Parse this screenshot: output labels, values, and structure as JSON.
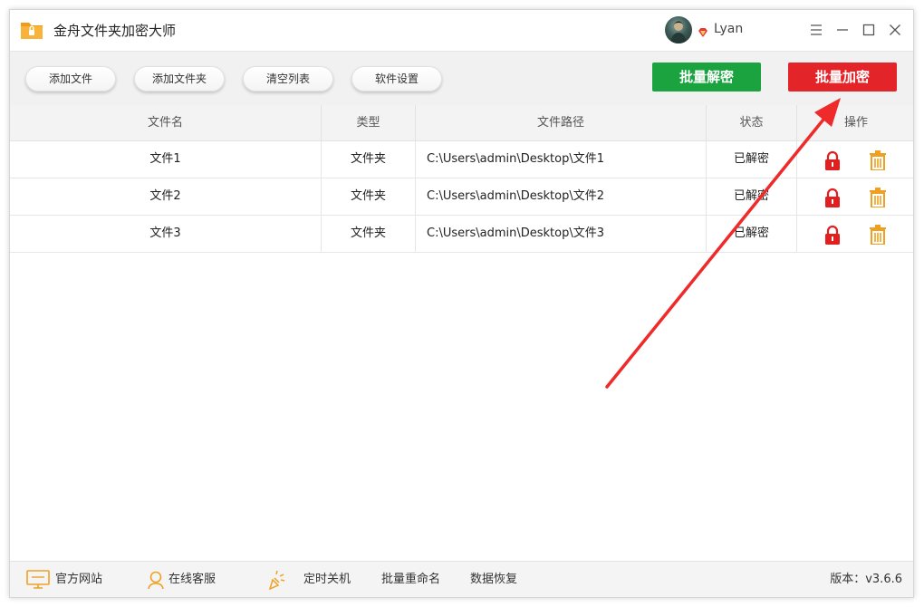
{
  "app": {
    "title": "金舟文件夹加密大师",
    "username": "Lyan"
  },
  "toolbar": {
    "add_file": "添加文件",
    "add_folder": "添加文件夹",
    "clear_list": "清空列表",
    "settings": "软件设置",
    "batch_decrypt": "批量解密",
    "batch_encrypt": "批量加密"
  },
  "table": {
    "headers": {
      "name": "文件名",
      "type": "类型",
      "path": "文件路径",
      "status": "状态",
      "actions": "操作"
    },
    "rows": [
      {
        "name": "文件1",
        "type": "文件夹",
        "path": "C:\\Users\\admin\\Desktop\\文件1",
        "status": "已解密"
      },
      {
        "name": "文件2",
        "type": "文件夹",
        "path": "C:\\Users\\admin\\Desktop\\文件2",
        "status": "已解密"
      },
      {
        "name": "文件3",
        "type": "文件夹",
        "path": "C:\\Users\\admin\\Desktop\\文件3",
        "status": "已解密"
      }
    ]
  },
  "footer": {
    "official_site": "官方网站",
    "online_support": "在线客服",
    "scheduled_shutdown": "定时关机",
    "batch_rename": "批量重命名",
    "data_recovery": "数据恢复",
    "version": "版本：v3.6.6"
  },
  "icons": {
    "logo": "folder-lock-icon",
    "vip": "vip-diamond-icon",
    "menu": "menu-icon",
    "minimize": "minimize-icon",
    "maximize": "maximize-icon",
    "close": "close-icon",
    "lock": "lock-icon",
    "delete": "trash-icon",
    "monitor": "monitor-icon",
    "support": "headset-icon",
    "shutdown": "timer-icon"
  },
  "colors": {
    "decrypt_button": "#1aa33e",
    "encrypt_button": "#e32428",
    "lock_icon": "#e02020",
    "trash_icon": "#f0a020",
    "arrow": "#ef2a2a"
  }
}
